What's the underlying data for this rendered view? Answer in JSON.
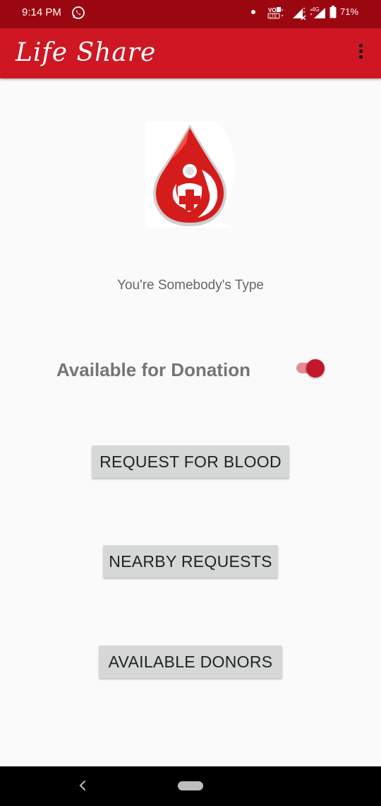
{
  "status_bar": {
    "time": "9:14 PM",
    "battery_percent": "71%",
    "network_label": "4G",
    "volte_label": "VoLTE",
    "icons": [
      "whatsapp-icon",
      "dot-icon",
      "volte-icon",
      "signal-icon",
      "battery-icon"
    ]
  },
  "app_bar": {
    "title": "Life Share",
    "menu_icon": "overflow-menu-icon"
  },
  "main": {
    "logo_icon": "blood-drop-logo",
    "tagline": "You're Somebody's Type",
    "availability": {
      "label": "Available for Donation",
      "enabled": true
    },
    "buttons": {
      "request_blood": "REQUEST FOR BLOOD",
      "nearby_requests": "NEARBY REQUESTS",
      "available_donors": "AVAILABLE DONORS"
    }
  },
  "colors": {
    "status_bar": "#9b0711",
    "app_bar": "#ce1723",
    "accent": "#c2182c",
    "background": "#fafafa",
    "button": "#d6d7d7"
  },
  "nav_bar": {
    "back_icon": "back-chevron-icon",
    "home_icon": "home-pill-icon"
  }
}
